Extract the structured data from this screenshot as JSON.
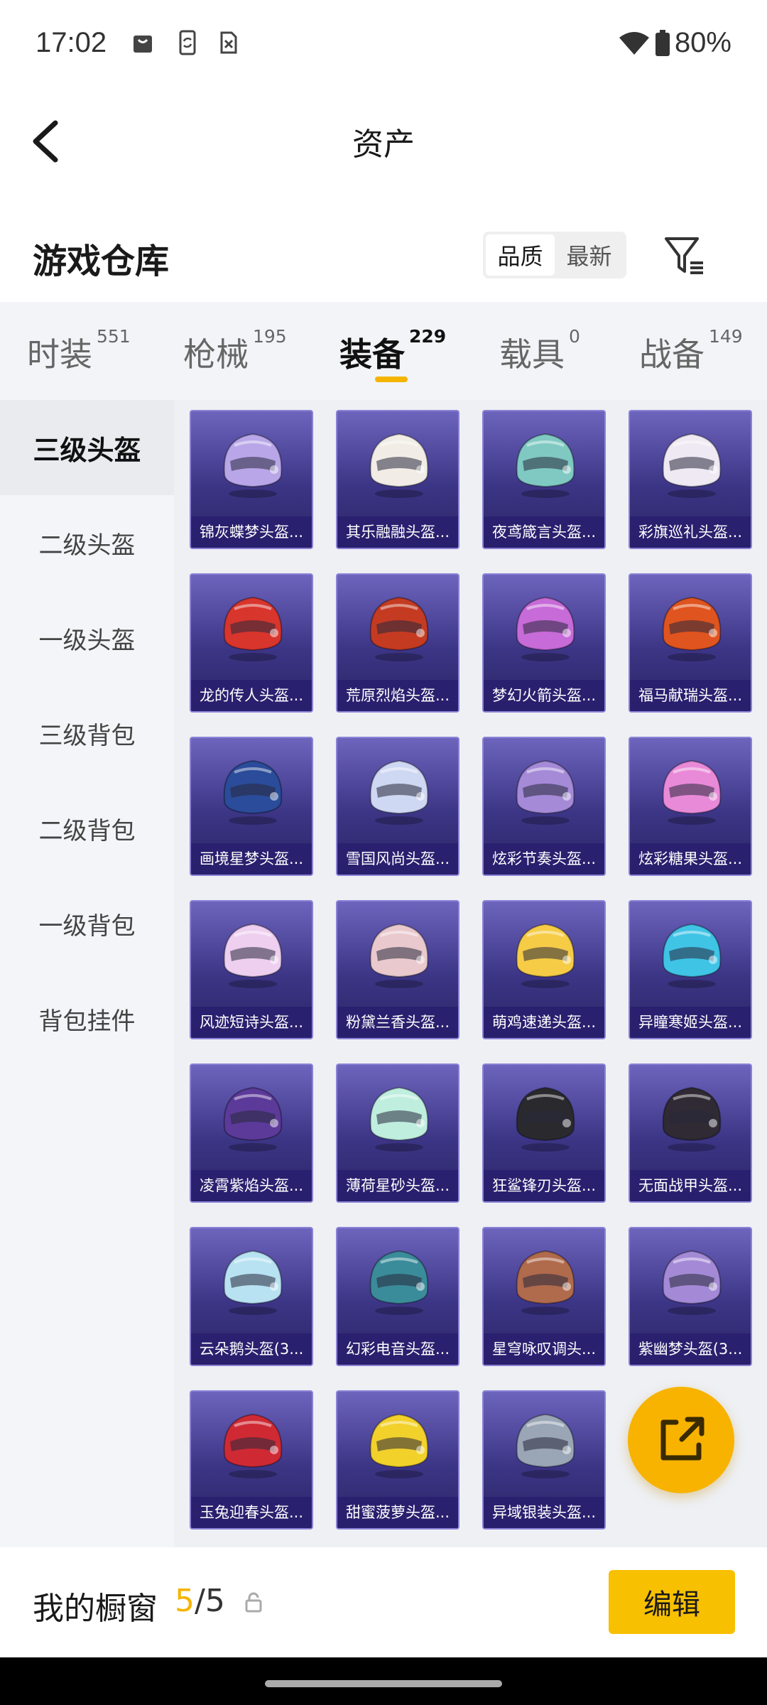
{
  "status_bar": {
    "time": "17:02",
    "battery": "80%",
    "icons": [
      "shopping-bag-icon",
      "phone-sync-icon",
      "sim-off-icon",
      "wifi-icon",
      "battery-icon"
    ]
  },
  "header": {
    "title": "资产"
  },
  "warehouse": {
    "title": "游戏仓库",
    "sort_options": [
      "品质",
      "最新"
    ],
    "active_sort": "品质"
  },
  "tabs": [
    {
      "label": "时装",
      "count": "551"
    },
    {
      "label": "枪械",
      "count": "195"
    },
    {
      "label": "装备",
      "count": "229"
    },
    {
      "label": "载具",
      "count": "0"
    },
    {
      "label": "战备",
      "count": "149"
    }
  ],
  "active_tab": "装备",
  "sidebar": {
    "items": [
      "三级头盔",
      "二级头盔",
      "一级头盔",
      "三级背包",
      "二级背包",
      "一级背包",
      "背包挂件"
    ],
    "active": "三级头盔"
  },
  "items": [
    {
      "name": "锦灰蝶梦头盔...",
      "color": "#b9a6e8"
    },
    {
      "name": "其乐融融头盔...",
      "color": "#f1ede6"
    },
    {
      "name": "夜鸢箴言头盔...",
      "color": "#7fc9c2"
    },
    {
      "name": "彩旗巡礼头盔...",
      "color": "#efe9f3"
    },
    {
      "name": "龙的传人头盔...",
      "color": "#d8352c"
    },
    {
      "name": "荒原烈焰头盔...",
      "color": "#c43b22"
    },
    {
      "name": "梦幻火箭头盔...",
      "color": "#c76bd8"
    },
    {
      "name": "福马献瑞头盔...",
      "color": "#e0541f"
    },
    {
      "name": "画境星梦头盔...",
      "color": "#2a4c9a"
    },
    {
      "name": "雪国风尚头盔...",
      "color": "#cfd8f2"
    },
    {
      "name": "炫彩节奏头盔...",
      "color": "#a58ad8"
    },
    {
      "name": "炫彩糖果头盔...",
      "color": "#e98ad8"
    },
    {
      "name": "风迹短诗头盔...",
      "color": "#eecff0"
    },
    {
      "name": "粉黛兰香头盔...",
      "color": "#e9c9ce"
    },
    {
      "name": "萌鸡速递头盔...",
      "color": "#f6cc47"
    },
    {
      "name": "异瞳寒姬头盔...",
      "color": "#3fc4e6"
    },
    {
      "name": "凌霄紫焰头盔...",
      "color": "#5c3a9a"
    },
    {
      "name": "薄荷星砂头盔...",
      "color": "#bfeede"
    },
    {
      "name": "狂鲨锋刃头盔...",
      "color": "#2a2a2e"
    },
    {
      "name": "无面战甲头盔...",
      "color": "#2f2a33"
    },
    {
      "name": "云朵鹅头盔(3...",
      "color": "#b8e2f2"
    },
    {
      "name": "幻彩电音头盔...",
      "color": "#3b8c9a"
    },
    {
      "name": "星穹咏叹调头...",
      "color": "#b06a4c"
    },
    {
      "name": "紫幽梦头盔(3...",
      "color": "#a48ad6"
    },
    {
      "name": "玉兔迎春头盔...",
      "color": "#cf2a34"
    },
    {
      "name": "甜蜜菠萝头盔...",
      "color": "#f2d12b"
    },
    {
      "name": "异域银装头盔...",
      "color": "#9aa6b6"
    }
  ],
  "showcase": {
    "label": "我的橱窗",
    "current": "5",
    "separator": "/",
    "total": "5",
    "edit_label": "编辑"
  },
  "colors": {
    "accent": "#f7c000",
    "card_bg": "#3c3585"
  }
}
